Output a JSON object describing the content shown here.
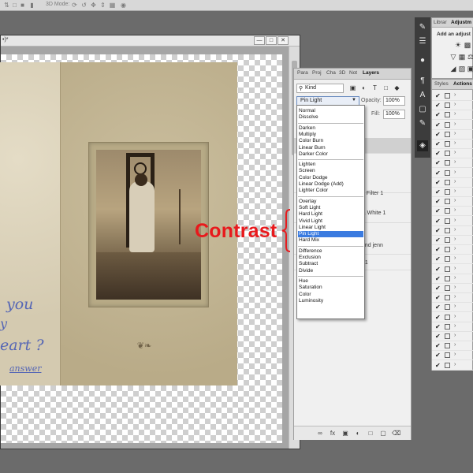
{
  "topbar": {
    "mode_label": "3D Mode:"
  },
  "document": {
    "title": "•)*",
    "minimize": "—",
    "maximize": "□",
    "close": "✕"
  },
  "card": {
    "handwriting": [
      "you",
      "y",
      "eart ?",
      "answer"
    ]
  },
  "annotation": {
    "label": "Contrast",
    "color": "#e8191c"
  },
  "layers_panel": {
    "tabs": [
      "Para",
      "Proj",
      "Cha",
      "3D",
      "Not",
      "Layers"
    ],
    "active_tab": "Layers",
    "filter_kind": "Kind",
    "blend_mode": "Pin Light",
    "opacity_label": "Opacity:",
    "opacity_value": "100%",
    "fill_label": "Fill:",
    "fill_value": "100%",
    "layer_rows": [
      "o Filter 1",
      "& White 1",
      "and jenn",
      "01"
    ]
  },
  "blend_menu": {
    "groups": [
      [
        "Normal",
        "Dissolve"
      ],
      [
        "Darken",
        "Multiply",
        "Color Burn",
        "Linear Burn",
        "Darker Color"
      ],
      [
        "Lighten",
        "Screen",
        "Color Dodge",
        "Linear Dodge (Add)",
        "Lighter Color"
      ],
      [
        "Overlay",
        "Soft Light",
        "Hard Light",
        "Vivid Light",
        "Linear Light",
        "Pin Light",
        "Hard Mix"
      ],
      [
        "Difference",
        "Exclusion",
        "Subtract",
        "Divide"
      ],
      [
        "Hue",
        "Saturation",
        "Color",
        "Luminosity"
      ]
    ],
    "selected": "Pin Light",
    "selected_color": "#3a7be0"
  },
  "right_panel": {
    "tabs": [
      "Librar",
      "Adjustm"
    ],
    "active_tab": "Adjustm",
    "adjust_title": "Add an adjust",
    "tabs2": [
      "Styles",
      "Actions"
    ],
    "active_tab2": "Actions"
  },
  "icons": {
    "topbar": [
      "rotate-3d-icon",
      "roll-3d-icon",
      "drag-3d-icon",
      "slide-3d-icon",
      "scale-3d-icon",
      "camera-icon"
    ],
    "dock": [
      "brush-icon",
      "sliders-icon",
      "person-icon",
      "paragraph-icon",
      "character-icon",
      "cube-icon",
      "layers-icon"
    ],
    "layers_bottom": [
      "link-icon",
      "fx-icon",
      "mask-icon",
      "adjustment-icon",
      "folder-icon",
      "new-layer-icon",
      "trash-icon"
    ]
  }
}
